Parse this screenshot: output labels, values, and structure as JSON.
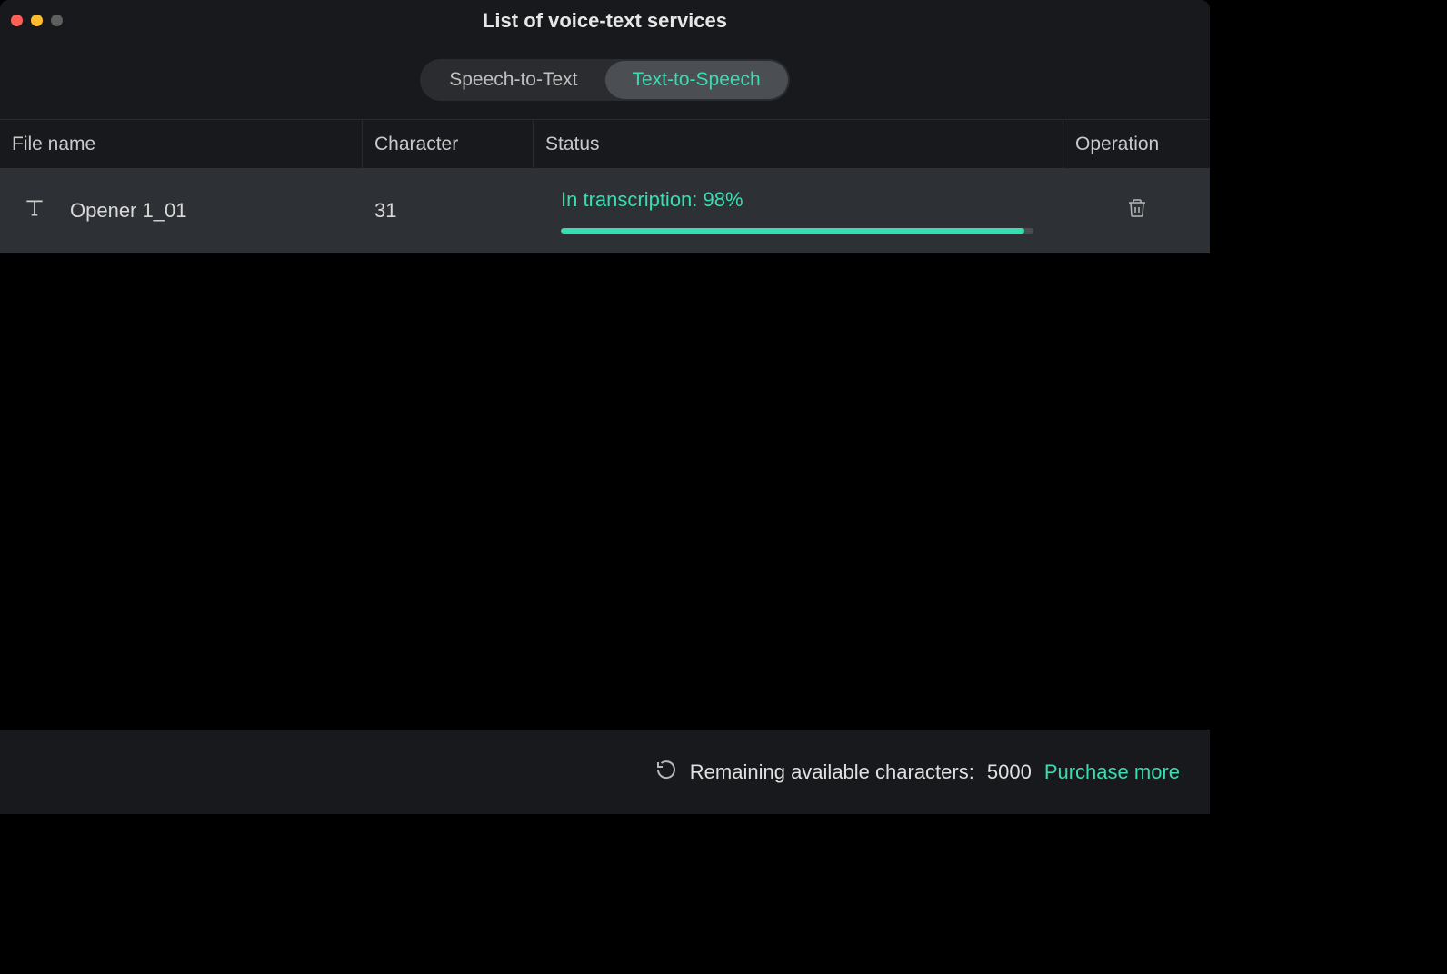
{
  "header": {
    "title": "List of voice-text services"
  },
  "tabs": {
    "speech_to_text": "Speech-to-Text",
    "text_to_speech": "Text-to-Speech"
  },
  "columns": {
    "file_name": "File name",
    "character": "Character",
    "status": "Status",
    "operation": "Operation"
  },
  "rows": [
    {
      "file_name": "Opener 1_01",
      "character": "31",
      "status_text": "In transcription: 98%",
      "progress_percent": "98"
    }
  ],
  "footer": {
    "remaining_label": "Remaining available characters:",
    "remaining_count": "5000",
    "purchase_label": "Purchase more"
  }
}
